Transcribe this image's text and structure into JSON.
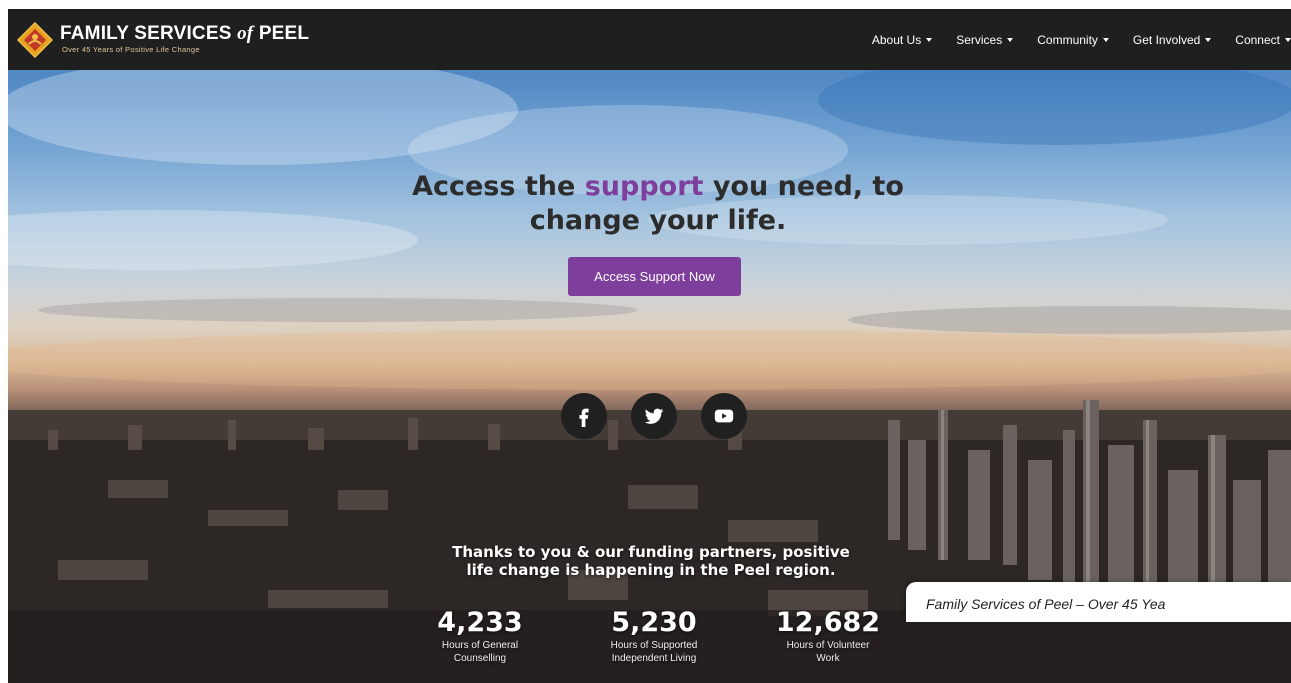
{
  "brand": {
    "title_main": "FAMILY SERVICES",
    "title_of": "of",
    "title_end": "PEEL",
    "tagline": "Over 45 Years of Positive Life Change"
  },
  "nav": {
    "items": [
      {
        "label": "About Us"
      },
      {
        "label": "Services"
      },
      {
        "label": "Community"
      },
      {
        "label": "Get Involved"
      },
      {
        "label": "Connect"
      }
    ]
  },
  "hero": {
    "headline_pre": "Access the ",
    "headline_accent": "support",
    "headline_post": " you need, to",
    "headline_line2": "change your life.",
    "cta_label": "Access Support Now"
  },
  "social": {
    "icons": [
      "facebook-icon",
      "twitter-icon",
      "youtube-icon"
    ]
  },
  "impact": {
    "message_line1": "Thanks to you & our funding partners, positive",
    "message_line2": "life change is happening in the Peel region.",
    "stats": [
      {
        "value": "4,233",
        "label_line1": "Hours of General",
        "label_line2": "Counselling"
      },
      {
        "value": "5,230",
        "label_line1": "Hours of Supported",
        "label_line2": "Independent Living"
      },
      {
        "value": "12,682",
        "label_line1": "Hours of Volunteer",
        "label_line2": "Work"
      }
    ]
  },
  "footer_banner": {
    "text": "Family Services of Peel – Over 45 Yea"
  },
  "colors": {
    "accent": "#7d3f9b",
    "navbar": "#1f1f1f"
  }
}
